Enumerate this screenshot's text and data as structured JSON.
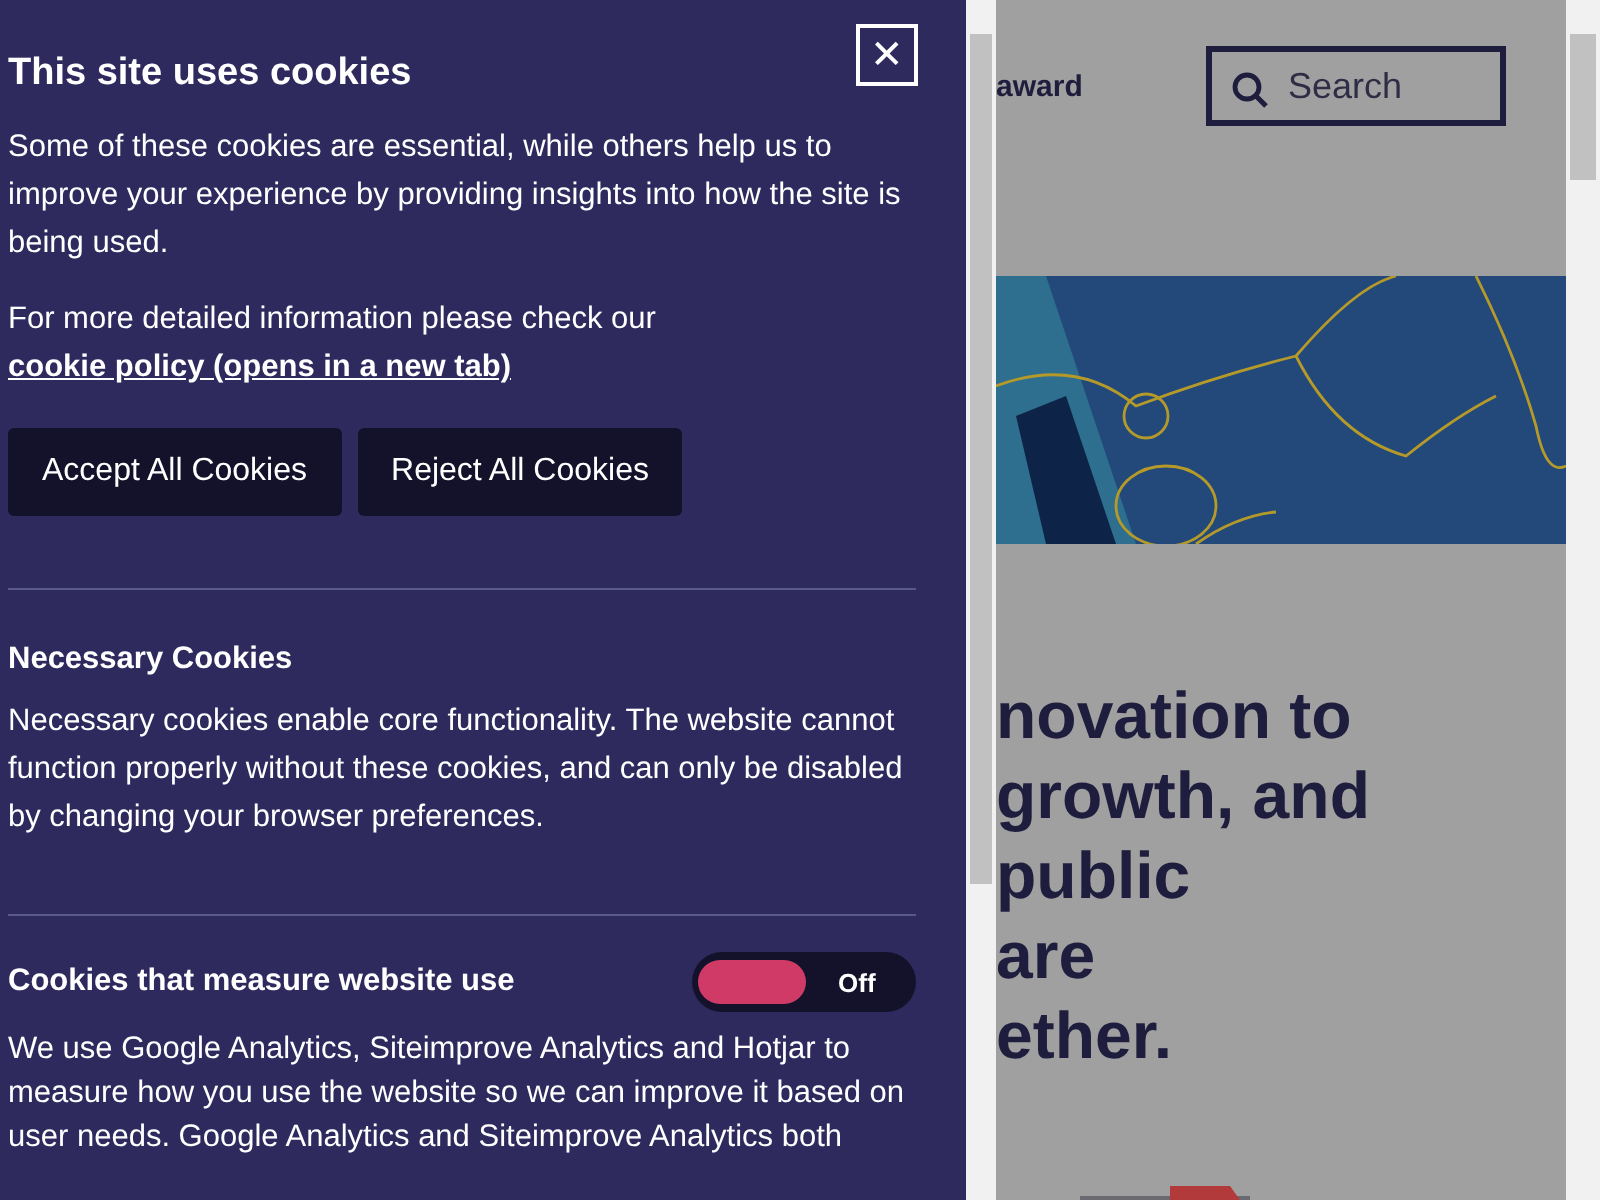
{
  "cookie_dialog": {
    "title": "This site uses cookies",
    "close_label": "✕",
    "intro": "Some of these cookies are essential, while others help us to improve your experience by providing insights into how the site is being used.",
    "policy_text": "For more detailed information please check our ",
    "policy_link": "cookie policy (opens in a new tab)",
    "buttons": [
      "Accept All Cookies",
      "Reject All Cookies"
    ],
    "sections": [
      {
        "kind": "info",
        "title": "Necessary Cookies",
        "text": "Necessary cookies enable core functionality. The website cannot function properly without these cookies, and can only be disabled by changing your browser preferences."
      },
      {
        "kind": "toggle",
        "title": "Cookies that measure website use",
        "on": false,
        "state_label": "Off",
        "text": "We use Google Analytics, Siteimprove Analytics and Hotjar to measure how you use the website so we can improve it based on user needs. Google Analytics and Siteimprove Analytics both"
      }
    ]
  },
  "page": {
    "nav_fragment": "award",
    "search": {
      "placeholder": "Search"
    },
    "headline_lines": [
      "novation to",
      "growth, and",
      "public",
      "are",
      "ether."
    ]
  }
}
